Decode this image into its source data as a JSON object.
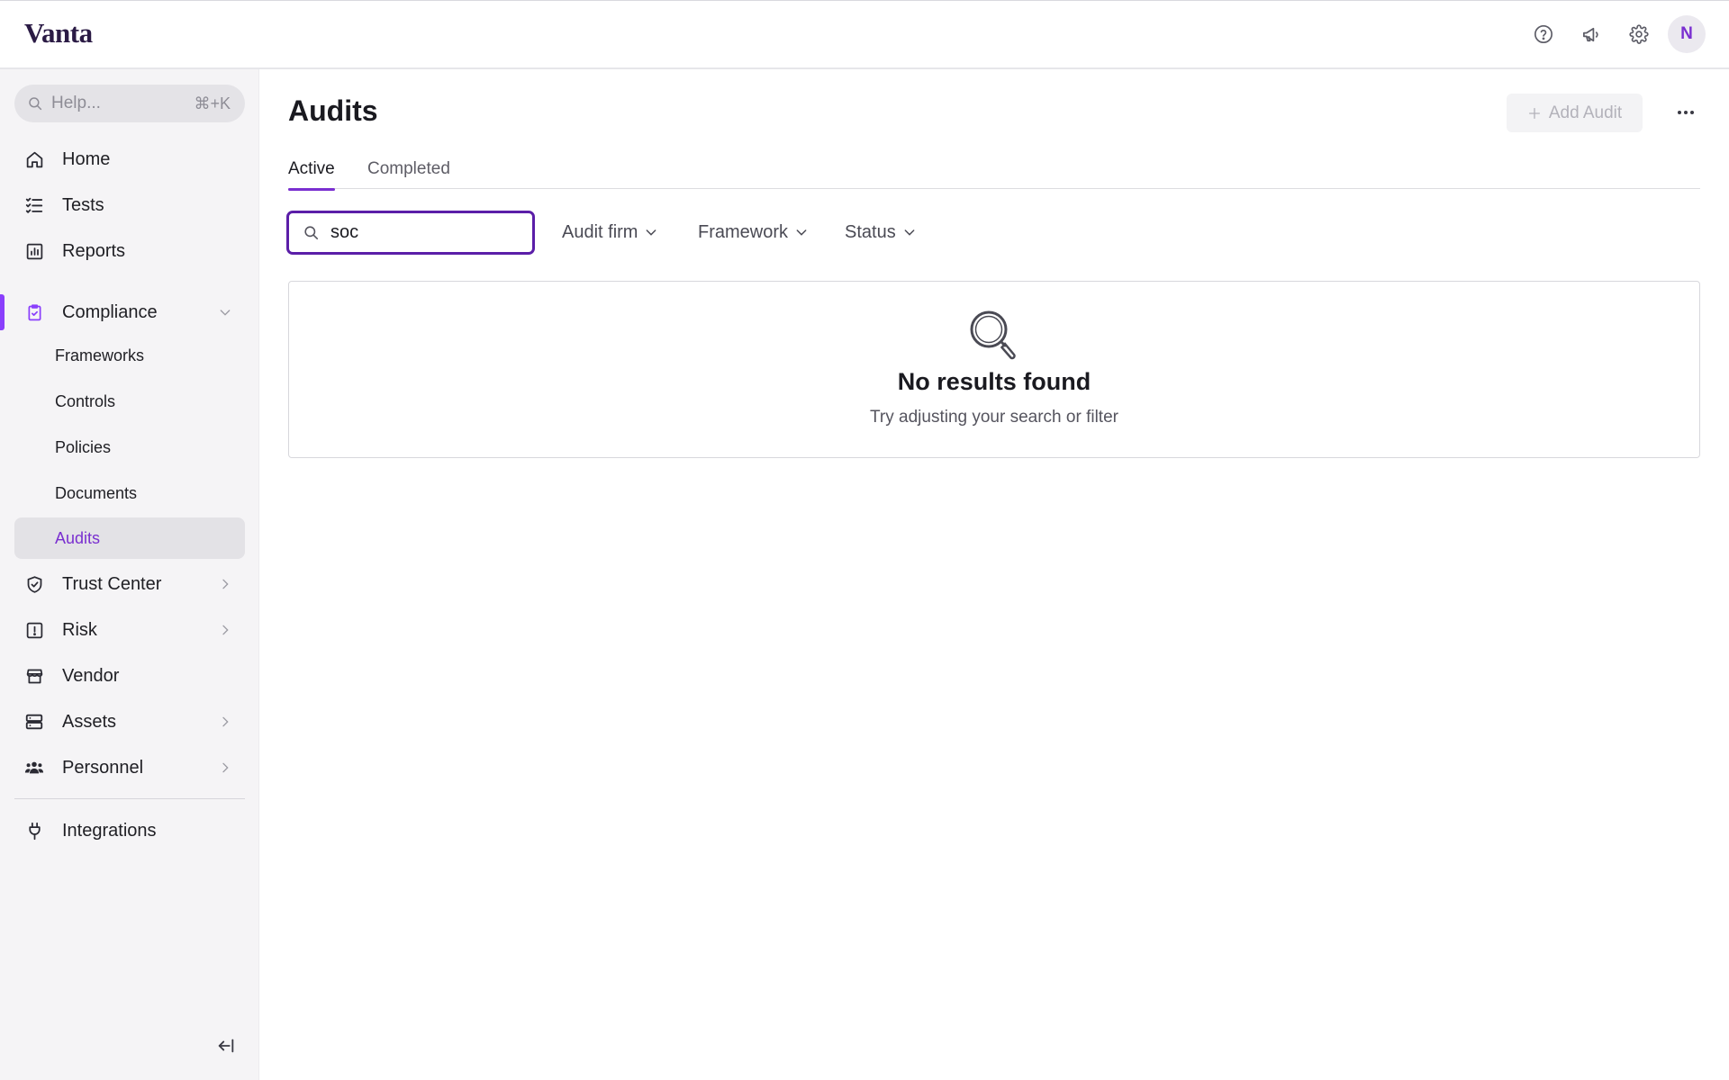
{
  "app": {
    "logo": "Vanta"
  },
  "topbar": {
    "icons": [
      "help-circle-icon",
      "megaphone-icon",
      "gear-icon"
    ],
    "avatar_initial": "N"
  },
  "sidebar": {
    "search": {
      "placeholder": "Help...",
      "shortcut": "⌘+K"
    },
    "items": {
      "home": "Home",
      "tests": "Tests",
      "reports": "Reports",
      "compliance": "Compliance",
      "frameworks": "Frameworks",
      "controls": "Controls",
      "policies": "Policies",
      "documents": "Documents",
      "audits": "Audits",
      "trust_center": "Trust Center",
      "risk": "Risk",
      "vendor": "Vendor",
      "assets": "Assets",
      "personnel": "Personnel",
      "integrations": "Integrations"
    }
  },
  "main": {
    "title": "Audits",
    "add_button": "Add Audit",
    "tabs": {
      "active": "Active",
      "completed": "Completed"
    },
    "search": {
      "value": "soc"
    },
    "filters": {
      "audit_firm": "Audit firm",
      "framework": "Framework",
      "status": "Status"
    },
    "empty": {
      "title": "No results found",
      "subtitle": "Try adjusting your search or filter"
    }
  },
  "colors": {
    "accent": "#7a2fd0",
    "focus_border": "#5b1ea8",
    "sidebar_bg": "#f5f4f6"
  }
}
